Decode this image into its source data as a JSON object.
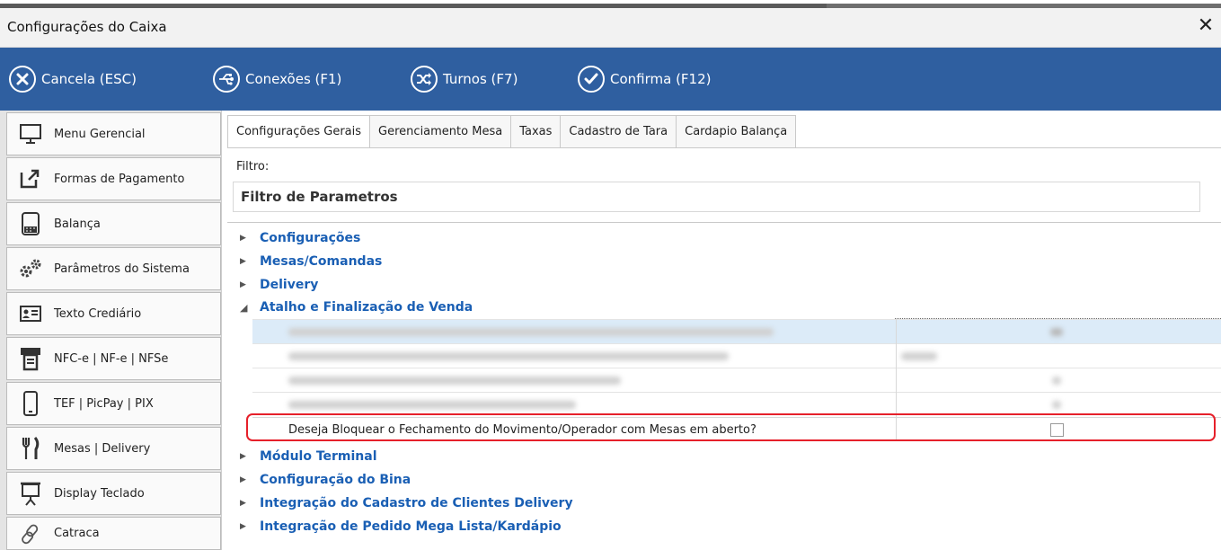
{
  "window": {
    "title": "Configurações do Caixa",
    "close": "✕"
  },
  "toolbar": {
    "cancel": {
      "label": "Cancela (ESC)",
      "icon": "x-circle-icon"
    },
    "connections": {
      "label": "Conexões (F1)",
      "icon": "usb-connection-icon"
    },
    "shifts": {
      "label": "Turnos (F7)",
      "icon": "shuffle-icon"
    },
    "confirm": {
      "label": "Confirma (F12)",
      "icon": "check-circle-icon"
    }
  },
  "sidebar": {
    "items": [
      {
        "label": "Menu Gerencial",
        "icon": "monitor-icon"
      },
      {
        "label": "Formas de Pagamento",
        "icon": "external-link-icon"
      },
      {
        "label": "Balança",
        "icon": "scale-icon"
      },
      {
        "label": "Parâmetros do Sistema",
        "icon": "gears-icon"
      },
      {
        "label": "Texto Crediário",
        "icon": "id-card-icon"
      },
      {
        "label": "NFC-e | NF-e | NFSe",
        "icon": "receipt-printer-icon"
      },
      {
        "label": "TEF | PicPay | PIX",
        "icon": "smartphone-icon"
      },
      {
        "label": "Mesas | Delivery",
        "icon": "fork-knife-icon"
      },
      {
        "label": "Display Teclado",
        "icon": "presentation-board-icon"
      },
      {
        "label": "Catraca",
        "icon": "link-icon"
      }
    ]
  },
  "tabs": [
    {
      "label": "Configurações Gerais",
      "active": true
    },
    {
      "label": "Gerenciamento Mesa"
    },
    {
      "label": "Taxas"
    },
    {
      "label": "Cadastro de Tara"
    },
    {
      "label": "Cardapio Balança"
    }
  ],
  "filter": {
    "label": "Filtro:",
    "placeholder": "Filtro de Parametros"
  },
  "categories": [
    {
      "label": "Configurações",
      "expanded": false
    },
    {
      "label": "Mesas/Comandas",
      "expanded": false
    },
    {
      "label": "Delivery",
      "expanded": false
    },
    {
      "label": "Atalho e Finalização de Venda",
      "expanded": true
    },
    {
      "label": "Módulo Terminal",
      "expanded": false
    },
    {
      "label": "Configuração do Bina",
      "expanded": false
    },
    {
      "label": "Integração do Cadastro de Clientes Delivery",
      "expanded": false
    },
    {
      "label": "Integração de Pedido Mega Lista/Kardápio",
      "expanded": false
    }
  ],
  "setting": {
    "label": "Deseja Bloquear o Fechamento do Movimento/Operador com Mesas em aberto?",
    "checked": false
  },
  "colors": {
    "toolbar": "#2f5fa0",
    "category": "#1a5fb4",
    "highlight": "#e6202a"
  }
}
